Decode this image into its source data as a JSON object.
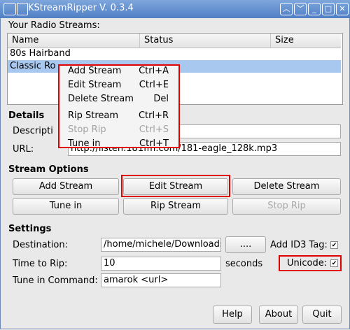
{
  "window": {
    "title": "KStreamRipper V. 0.3.4"
  },
  "streams": {
    "label": "Your Radio Streams:",
    "columns": [
      "Name",
      "Status",
      "Size"
    ],
    "rows": [
      {
        "name": "80s Hairband",
        "status": "",
        "size": ""
      },
      {
        "name": "Classic Ro",
        "status": "",
        "size": ""
      }
    ],
    "selected_row": 1
  },
  "context_menu": {
    "items": [
      {
        "label": "Add Stream",
        "shortcut": "Ctrl+A",
        "enabled": true
      },
      {
        "label": "Edit Stream",
        "shortcut": "Ctrl+E",
        "enabled": true
      },
      {
        "label": "Delete Stream",
        "shortcut": "Del",
        "enabled": true
      },
      {
        "label": "Rip Stream",
        "shortcut": "Ctrl+R",
        "enabled": true
      },
      {
        "label": "Stop Rip",
        "shortcut": "Ctrl+S",
        "enabled": false
      },
      {
        "label": "Tune in",
        "shortcut": "Ctrl+T",
        "enabled": true
      }
    ]
  },
  "details": {
    "title": "Details",
    "description_label": "Descripti",
    "description_value": "",
    "url_label": "URL:",
    "url_value": "http://listen.181fm.com/181-eagle_128k.mp3"
  },
  "stream_options": {
    "title": "Stream Options",
    "add": "Add Stream",
    "edit": "Edit Stream",
    "delete": "Delete Stream",
    "tune": "Tune in",
    "rip": "Rip Stream",
    "stop": "Stop Rip"
  },
  "settings": {
    "title": "Settings",
    "destination_label": "Destination:",
    "destination_value": "/home/michele/Downloads",
    "browse": "....",
    "id3_label": "Add ID3 Tag:",
    "id3_checked": true,
    "time_label": "Time to Rip:",
    "time_value": "10",
    "time_unit": "seconds",
    "unicode_label": "Unicode:",
    "unicode_checked": true,
    "tune_cmd_label": "Tune in Command:",
    "tune_cmd_value": "amarok <url>"
  },
  "footer": {
    "help": "Help",
    "about": "About",
    "quit": "Quit"
  }
}
